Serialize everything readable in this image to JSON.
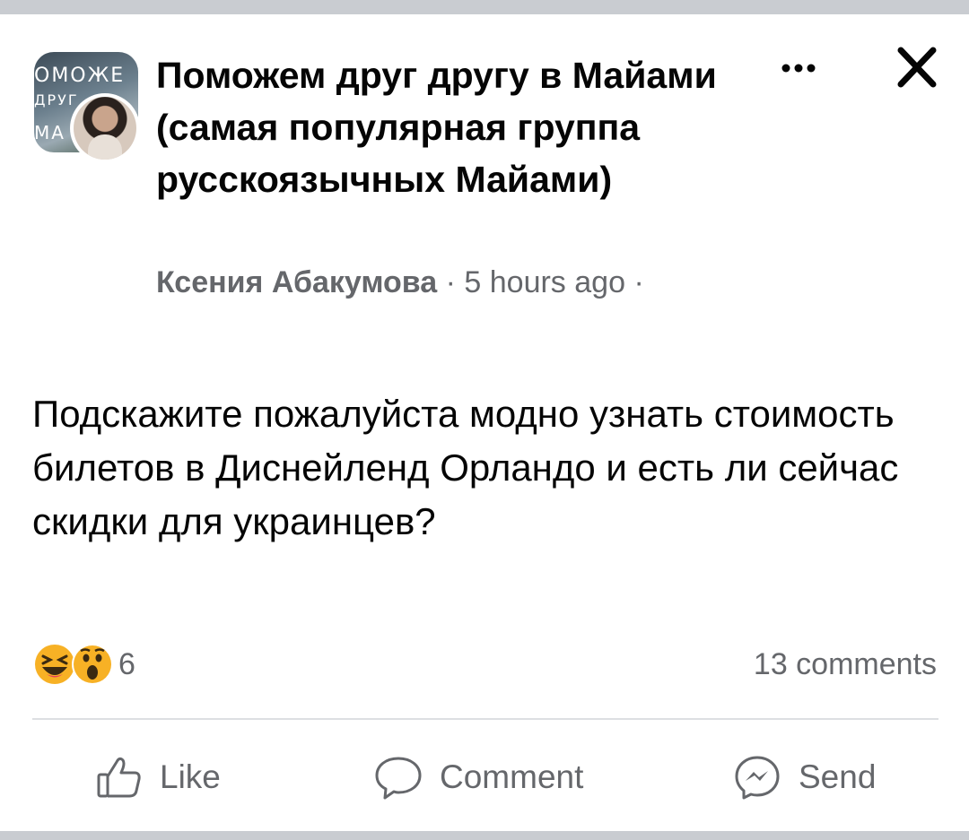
{
  "group": {
    "name": "Поможем друг другу в Майами (самая популярная группа русскоязычных Майами)",
    "avatar_text_line1": "ОМОЖЕ",
    "avatar_text_line2": "ДРУГ",
    "avatar_text_line3": "МА"
  },
  "post": {
    "author": "Ксения Абакумова",
    "separator": "·",
    "time": "5 hours ago",
    "text": "Подскажите пожалуйста модно узнать стоимость билетов в Диснейленд Орландо и есть ли сейчас скидки для украинцев?"
  },
  "stats": {
    "reaction_icons": [
      "laugh-emoji-icon",
      "wow-emoji-icon"
    ],
    "reaction_count": "6",
    "comments": "13 comments"
  },
  "actions": {
    "like": "Like",
    "comment": "Comment",
    "send": "Send"
  },
  "colors": {
    "text": "#050505",
    "secondary": "#65676b",
    "divider": "#dddfe2",
    "emoji_yellow": "#f7b125"
  },
  "icons": {
    "more": "more-horizontal-icon",
    "close": "close-icon",
    "like": "thumbs-up-icon",
    "comment": "speech-bubble-icon",
    "send": "messenger-icon"
  }
}
